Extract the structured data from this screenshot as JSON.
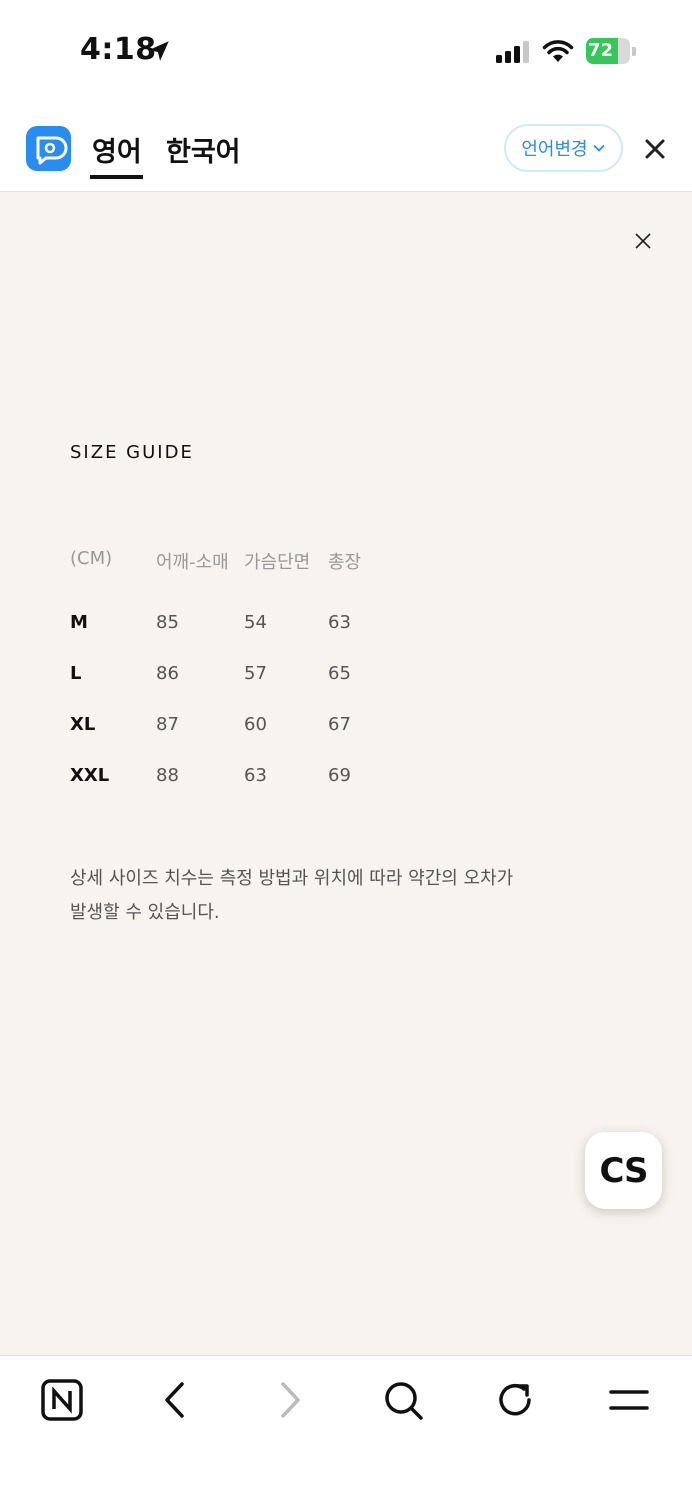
{
  "status": {
    "time": "4:18",
    "battery_level": "72",
    "battery_percent": 72
  },
  "translate_bar": {
    "tab_english": "영어",
    "tab_korean": "한국어",
    "selected_tab": "영어",
    "change_language_label": "언어변경"
  },
  "size_guide": {
    "title": "SIZE GUIDE",
    "headers": [
      "(CM)",
      "어깨-소매",
      "가슴단면",
      "총장"
    ],
    "rows": [
      {
        "size": "M",
        "shoulder_sleeve": "85",
        "chest": "54",
        "length": "63"
      },
      {
        "size": "L",
        "shoulder_sleeve": "86",
        "chest": "57",
        "length": "65"
      },
      {
        "size": "XL",
        "shoulder_sleeve": "87",
        "chest": "60",
        "length": "67"
      },
      {
        "size": "XXL",
        "shoulder_sleeve": "88",
        "chest": "63",
        "length": "69"
      }
    ],
    "note_line1": "상세 사이즈 치수는 측정 방법과 위치에 따라 약간의 오차가",
    "note_line2": "발생할 수 있습니다."
  },
  "cs_button_label": "CS",
  "toolbar": {
    "icons": [
      "naver-home-icon",
      "back-arrow-icon",
      "forward-arrow-icon",
      "search-icon",
      "refresh-icon",
      "menu-icon"
    ]
  },
  "colors": {
    "accent": "#2a8cf0",
    "background": "#f7f3ee",
    "battery_green": "#34c759"
  }
}
